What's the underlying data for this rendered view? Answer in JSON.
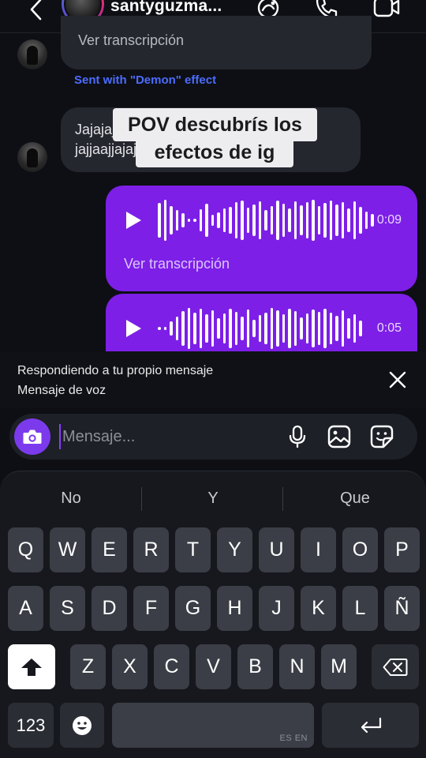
{
  "header": {
    "contact_name": "santyguzma...",
    "icons": [
      "chevron-left-icon",
      "effects-icon",
      "phone-icon",
      "video-camera-icon"
    ]
  },
  "thread": {
    "transcript_link_top": "Ver transcripción",
    "effect_label": "Sent with \"Demon\" effect",
    "incoming_text": "Jajajaja no llega la señal al infierno jajjaajjajajajaja",
    "overlay_caption_line1": "POV descubrís los",
    "overlay_caption_line2": "efectos de ig",
    "voice_messages": [
      {
        "duration": "0:09",
        "transcript_link": "Ver transcripción"
      },
      {
        "duration": "0:05"
      }
    ]
  },
  "reply": {
    "title": "Respondiendo a tu propio mensaje",
    "subtitle": "Mensaje de voz"
  },
  "composer": {
    "placeholder": "Mensaje...",
    "icons": [
      "camera-icon",
      "microphone-icon",
      "image-icon",
      "sticker-icon"
    ]
  },
  "keyboard": {
    "suggestions": [
      "No",
      "Y",
      "Que"
    ],
    "row1": [
      "Q",
      "W",
      "E",
      "R",
      "T",
      "Y",
      "U",
      "I",
      "O",
      "P"
    ],
    "row2": [
      "A",
      "S",
      "D",
      "F",
      "G",
      "H",
      "J",
      "K",
      "L",
      "Ñ"
    ],
    "row3": [
      "Z",
      "X",
      "C",
      "V",
      "B",
      "N",
      "M"
    ],
    "numbers_label": "123",
    "space_language": "ES EN"
  },
  "colors": {
    "accent_purple": "#7d1fe7",
    "effect_blue": "#4c6cff",
    "background": "#0d0f14"
  }
}
